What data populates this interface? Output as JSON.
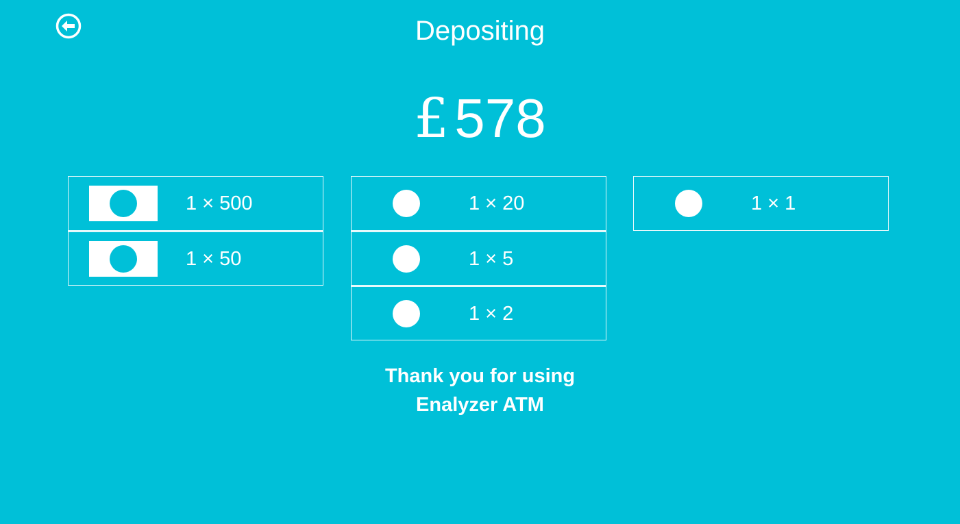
{
  "header": {
    "title": "Depositing"
  },
  "deposit": {
    "currency_symbol": "£",
    "amount": "578"
  },
  "denominations": {
    "notes": [
      {
        "label": "1 × 500",
        "icon": "banknote-icon"
      },
      {
        "label": "1 × 50",
        "icon": "banknote-icon"
      }
    ],
    "coins_1": [
      {
        "label": "1 × 20",
        "icon": "coin-icon"
      },
      {
        "label": "1 × 5",
        "icon": "coin-icon"
      },
      {
        "label": "1 × 2",
        "icon": "coin-icon"
      }
    ],
    "coins_2": [
      {
        "label": "1 × 1",
        "icon": "coin-icon"
      }
    ]
  },
  "footer": {
    "line1": "Thank you for using",
    "line2": "Enalyzer ATM"
  },
  "colors": {
    "background": "#00c0d8",
    "foreground": "#ffffff"
  }
}
